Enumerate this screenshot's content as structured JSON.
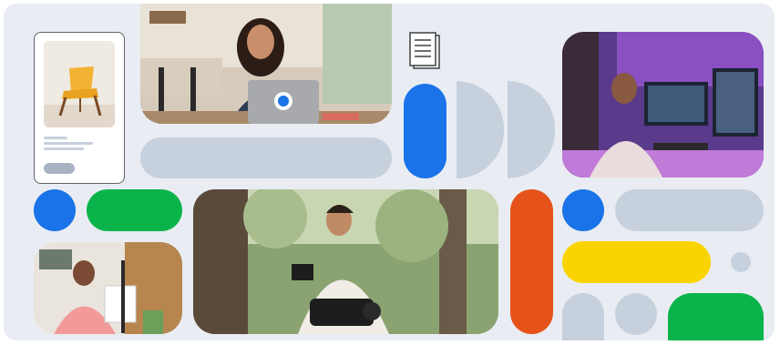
{
  "colors": {
    "background": "#e9edf3",
    "grey": "#c7d0dd",
    "blue": "#1a73e8",
    "green": "#0bb44b",
    "yellow": "#fbd400",
    "red": "#e6531a"
  },
  "icons": {
    "document": "document-icon",
    "laptop_logo": "copilot-logo-icon"
  }
}
